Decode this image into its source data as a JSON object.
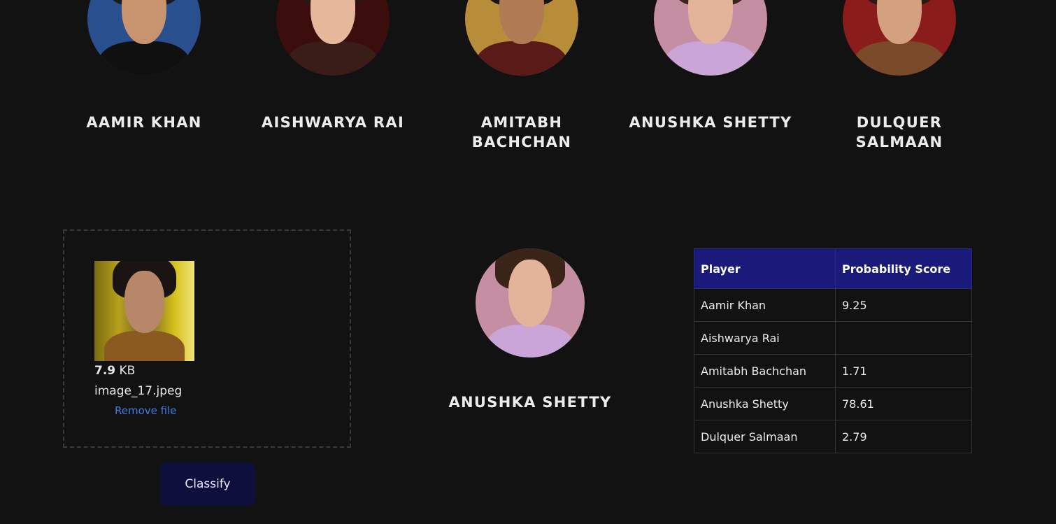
{
  "celebrities": [
    {
      "name": "Aamir Khan",
      "skin": "#c8936f",
      "hair": "#1b1b1b",
      "cloth": "#101010",
      "bg": "#2a4f8f"
    },
    {
      "name": "Aishwarya Rai",
      "skin": "#e5b79b",
      "hair": "#2a1510",
      "cloth": "#3a1d18",
      "bg": "#3b0d0d"
    },
    {
      "name": "Amitabh Bachchan",
      "skin": "#b07a55",
      "hair": "#1a1410",
      "cloth": "#5a1a18",
      "bg": "#b88d3a"
    },
    {
      "name": "Anushka Shetty",
      "skin": "#e3b39a",
      "hair": "#3a2418",
      "cloth": "#c9a5d8",
      "bg": "#c48fa2"
    },
    {
      "name": "Dulquer Salmaan",
      "skin": "#d4a180",
      "hair": "#2a1a10",
      "cloth": "#7a4a2a",
      "bg": "#8a1c1c"
    }
  ],
  "upload": {
    "size_value": "7.9",
    "size_unit": "KB",
    "filename": "image_17.jpeg",
    "remove_label": "Remove file"
  },
  "classify_label": "Classify",
  "result": {
    "name": "Anushka Shetty"
  },
  "table": {
    "headers": [
      "Player",
      "Probability Score"
    ],
    "rows": [
      {
        "player": "Aamir Khan",
        "score": "9.25"
      },
      {
        "player": "Aishwarya Rai",
        "score": ""
      },
      {
        "player": "Amitabh Bachchan",
        "score": "1.71"
      },
      {
        "player": "Anushka Shetty",
        "score": "78.61"
      },
      {
        "player": "Dulquer Salmaan",
        "score": "2.79"
      }
    ]
  },
  "colors": {
    "background": "#121212",
    "header_bg": "#1a1a7a",
    "button_bg": "#0f0f3e",
    "link": "#3d7de0"
  }
}
